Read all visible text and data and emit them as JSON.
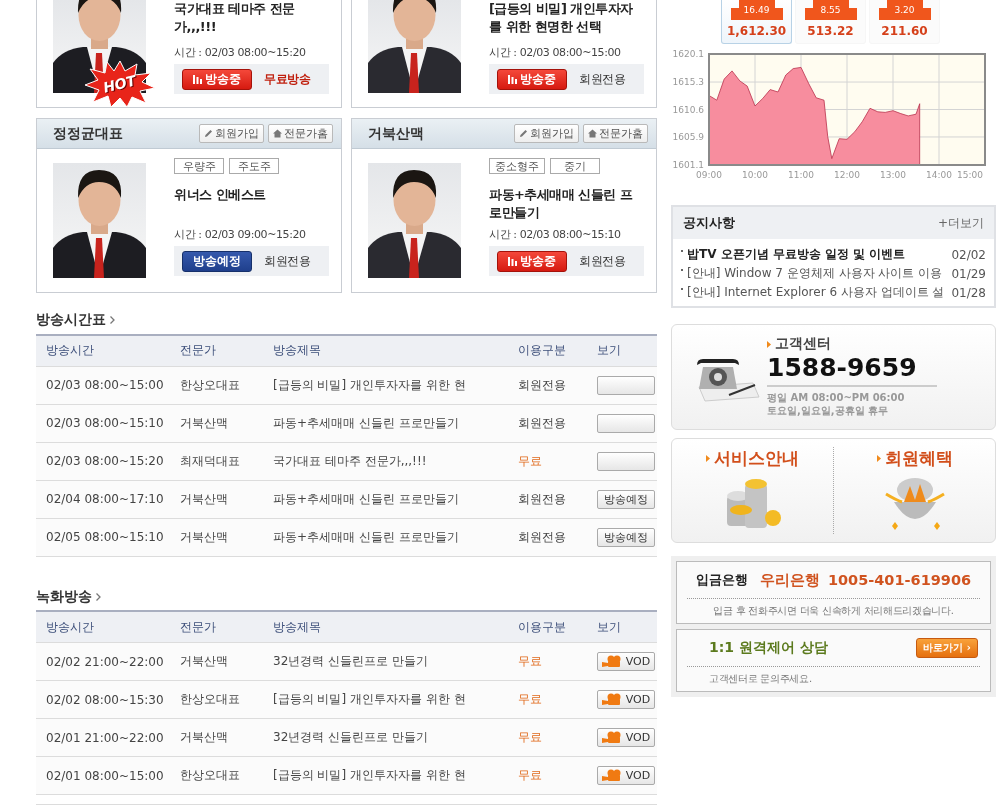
{
  "expert_cards": [
    {
      "hot_badge": "HOT",
      "title": "국가대표 테마주 전문가,,,!!!",
      "time": "시간 : 02/03 08:00~15:20",
      "status": {
        "kind": "live",
        "label": "방송중"
      },
      "access": {
        "label": "무료방송",
        "free": true
      }
    },
    {
      "title": "[급등의 비밀] 개인투자자를 위한 현명한 선택",
      "time": "시간 : 02/03 08:00~15:00",
      "status": {
        "kind": "live",
        "label": "방송중"
      },
      "access": {
        "label": "회원전용",
        "free": false
      }
    },
    {
      "name": "정정균대표",
      "buttons": [
        {
          "kind": "join",
          "label": "회원가입"
        },
        {
          "kind": "home",
          "label": "전문가홈"
        }
      ],
      "tags": [
        "우량주",
        "주도주"
      ],
      "title": "위너스 인베스트",
      "time": "시간 : 02/03 09:00~15:20",
      "status": {
        "kind": "scheduled",
        "label": "방송예정"
      },
      "access": {
        "label": "회원전용",
        "free": false
      }
    },
    {
      "name": "거북산맥",
      "buttons": [
        {
          "kind": "join",
          "label": "회원가입"
        },
        {
          "kind": "home",
          "label": "전문가홈"
        }
      ],
      "tags": [
        "중소형주",
        "중기"
      ],
      "title": "파동+추세매매 신들린 프로만들기",
      "time": "시간 : 02/03 08:00~15:10",
      "status": {
        "kind": "live",
        "label": "방송중"
      },
      "access": {
        "label": "회원전용",
        "free": false
      }
    }
  ],
  "schedule": {
    "title": "방송시간표",
    "columns": [
      "방송시간",
      "전문가",
      "방송제목",
      "이용구분",
      "보기"
    ],
    "rows": [
      {
        "time": "02/03 08:00~15:00",
        "expert": "한상오대표",
        "title": "[급등의 비밀] 개인투자자를 위한 현",
        "access": {
          "label": "회원전용",
          "free": false
        },
        "view": {
          "kind": "blank"
        }
      },
      {
        "time": "02/03 08:00~15:10",
        "expert": "거북산맥",
        "title": "파동+추세매매 신들린 프로만들기",
        "access": {
          "label": "회원전용",
          "free": false
        },
        "view": {
          "kind": "blank"
        }
      },
      {
        "time": "02/03 08:00~15:20",
        "expert": "최재덕대표",
        "title": "국가대표 테마주 전문가,,,!!!",
        "access": {
          "label": "무료",
          "free": true
        },
        "view": {
          "kind": "blank"
        }
      },
      {
        "time": "02/04 08:00~17:10",
        "expert": "거북산맥",
        "title": "파동+추세매매 신들린 프로만들기",
        "access": {
          "label": "회원전용",
          "free": false
        },
        "view": {
          "kind": "text",
          "label": "방송예정"
        }
      },
      {
        "time": "02/05 08:00~15:10",
        "expert": "거북산맥",
        "title": "파동+추세매매 신들린 프로만들기",
        "access": {
          "label": "회원전용",
          "free": false
        },
        "view": {
          "kind": "text",
          "label": "방송예정"
        }
      }
    ]
  },
  "recorded": {
    "title": "녹화방송",
    "columns": [
      "방송시간",
      "전문가",
      "방송제목",
      "이용구분",
      "보기"
    ],
    "rows": [
      {
        "time": "02/02 21:00~22:00",
        "expert": "거북산맥",
        "title": "32년경력 신들린프로 만들기",
        "access": {
          "label": "무료",
          "free": true
        },
        "view": {
          "kind": "vod",
          "label": "VOD"
        }
      },
      {
        "time": "02/02 08:00~15:30",
        "expert": "한상오대표",
        "title": "[급등의 비밀] 개인투자자를 위한 현",
        "access": {
          "label": "무료",
          "free": true
        },
        "view": {
          "kind": "vod",
          "label": "VOD"
        }
      },
      {
        "time": "02/01 21:00~22:00",
        "expert": "거북산맥",
        "title": "32년경력 신들린프로 만들기",
        "access": {
          "label": "무료",
          "free": true
        },
        "view": {
          "kind": "vod",
          "label": "VOD"
        }
      },
      {
        "time": "02/01 08:00~15:00",
        "expert": "한상오대표",
        "title": "[급등의 비밀] 개인투자자를 위한 현",
        "access": {
          "label": "무료",
          "free": true
        },
        "view": {
          "kind": "vod",
          "label": "VOD"
        }
      }
    ]
  },
  "indices": [
    {
      "change": "16.49",
      "value": "1,612.30",
      "selected": true
    },
    {
      "change": "8.55",
      "value": "513.22",
      "selected": false
    },
    {
      "change": "3.20",
      "value": "211.60",
      "selected": false
    }
  ],
  "chart": {
    "chart_data": {
      "type": "area",
      "x": [
        9,
        9.17,
        9.33,
        9.5,
        9.67,
        9.83,
        10,
        10.17,
        10.33,
        10.5,
        10.67,
        10.83,
        11,
        11.17,
        11.33,
        11.5,
        11.58,
        11.67,
        11.83,
        12,
        12.17,
        12.33,
        12.5,
        12.67,
        12.83,
        13,
        13.17,
        13.33,
        13.5,
        13.58
      ],
      "grid": true,
      "series": [
        {
          "color": "#f78d9e",
          "values": [
            1613,
            1612.2,
            1615.8,
            1617.2,
            1615.5,
            1614.6,
            1611.2,
            1612.5,
            1614,
            1613.6,
            1616.5,
            1617.6,
            1617.8,
            1615,
            1612.6,
            1612.2,
            1606,
            1602.2,
            1605.6,
            1605.5,
            1606.8,
            1608.5,
            1610.8,
            1610.2,
            1610.1,
            1610.4,
            1609.9,
            1609.5,
            1609.8,
            1611.6
          ]
        }
      ],
      "xlim": [
        9,
        15
      ],
      "ylim": [
        1601.1,
        1620.1
      ],
      "xticks": [
        {
          "value": 9,
          "label": "09:00"
        },
        {
          "value": 10,
          "label": "10:00"
        },
        {
          "value": 11,
          "label": "11:00"
        },
        {
          "value": 12,
          "label": "12:00"
        },
        {
          "value": 13,
          "label": "13:00"
        },
        {
          "value": 14,
          "label": "14:00"
        },
        {
          "value": 15,
          "label": "15:00"
        }
      ],
      "yticks": [
        1601.1,
        1605.9,
        1610.6,
        1615.3,
        1620.1
      ]
    }
  },
  "notice": {
    "title": "공지사항",
    "more": "+더보기",
    "items": [
      {
        "text": "밥TV 오픈기념 무료방송 일정 및 이벤트",
        "date": "02/02",
        "highlight": true
      },
      {
        "text": "[안내] Window 7 운영체제 사용자 사이트 이용",
        "date": "01/29",
        "highlight": false
      },
      {
        "text": "[안내] Internet Explorer 6 사용자 업데이트 설",
        "date": "01/28",
        "highlight": false
      }
    ]
  },
  "customer_center": {
    "title": "고객센터",
    "phone": "1588-9659",
    "hours": [
      "평일 AM 08:00~PM 06:00",
      "토요일,일요일,공휴일 휴무"
    ]
  },
  "links": [
    {
      "kind": "coins",
      "label": "서비스안내"
    },
    {
      "kind": "bowl",
      "label": "회원혜택"
    }
  ],
  "bank": {
    "label": "입금은행",
    "bank": "우리은행",
    "account": "1005-401-619906",
    "note": "입금 후 전화주시면 더욱 신속하게 처리해드리겠습니다."
  },
  "remote": {
    "title": "1:1 원격제어 상담",
    "button": "바로가기 ›",
    "note": "고객센터로 문의주세요."
  }
}
